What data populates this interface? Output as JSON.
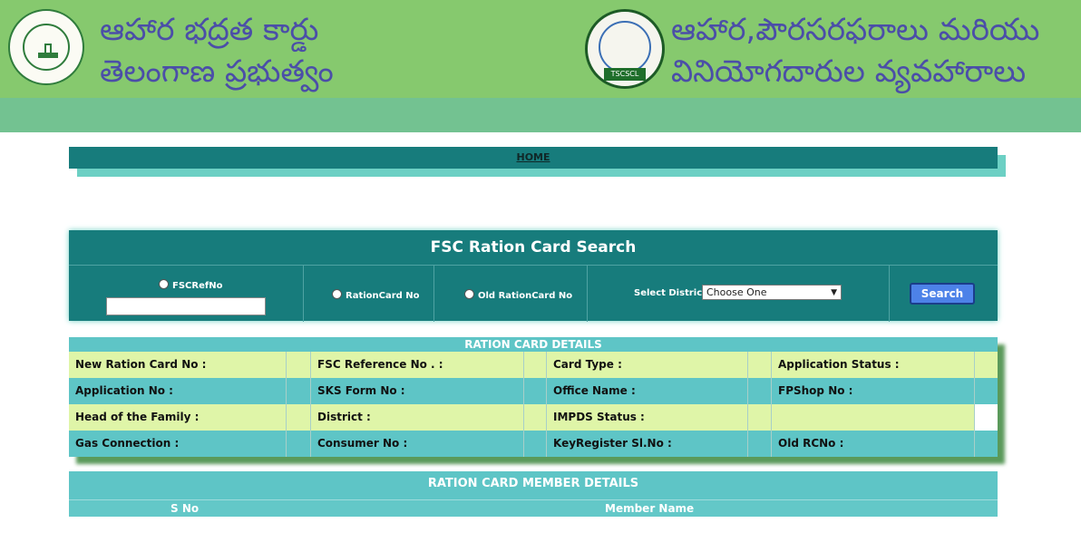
{
  "header": {
    "title_left_line1": "ఆహార భద్రత కార్డు",
    "title_left_line2": "తెలంగాణ ప్రభుత్వం",
    "title_right_line1": "ఆహార,పౌరసరఫరాలు మరియు",
    "title_right_line2": "వినియోగదారుల వ్యవహారాలు",
    "emblem_right_text": "TSCSCL",
    "colors": {
      "band_top": "#86c96e",
      "band_bottom": "#73c291",
      "title": "#4b4ea8"
    }
  },
  "nav": {
    "home_label": "HOME"
  },
  "search": {
    "title": "FSC Ration Card Search",
    "options": [
      "FSCRefNo",
      "RationCard No",
      "Old RationCard No"
    ],
    "fsc_input_value": "",
    "district_label": "Select District :",
    "district_selected": "Choose One",
    "search_button": "Search"
  },
  "details": {
    "title": "RATION CARD DETAILS",
    "rows": [
      [
        "New Ration Card No :",
        "FSC Reference No . :",
        "Card Type :",
        "Application Status :"
      ],
      [
        "Application No :",
        "SKS Form No :",
        "Office Name :",
        "FPShop No :"
      ],
      [
        "Head of the Family :",
        "District :",
        "IMPDS Status :",
        ""
      ],
      [
        "Gas Connection :",
        "Consumer No :",
        "KeyRegister Sl.No :",
        "Old RCNo :"
      ]
    ]
  },
  "members": {
    "title": "RATION CARD MEMBER DETAILS",
    "columns": [
      "S No",
      "Member Name"
    ]
  }
}
